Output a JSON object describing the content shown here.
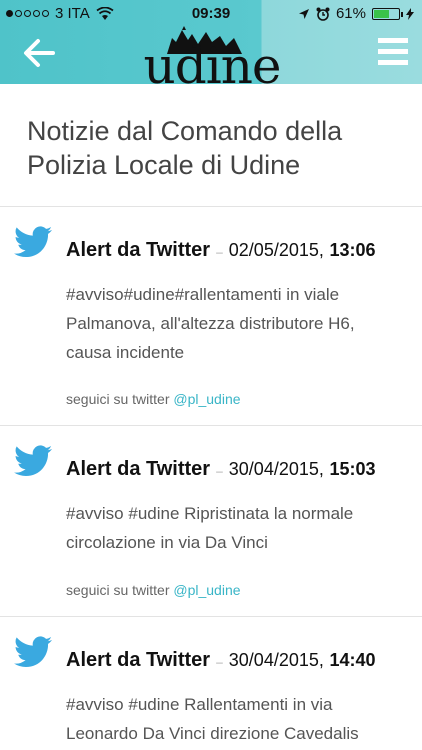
{
  "status_bar": {
    "carrier": "3 ITA",
    "time": "09:39",
    "battery": "61%"
  },
  "header": {
    "logo_text": "udine"
  },
  "page": {
    "title": "Notizie dal Comando della Polizia Locale di Udine"
  },
  "alerts": [
    {
      "source": "Alert da Twitter",
      "date": "02/05/2015,",
      "time": "13:06",
      "text": "#avviso#udine#rallentamenti in viale Palmanova, all'altezza distributore H6, causa incidente",
      "follow_label": "seguici su twitter",
      "handle": "@pl_udine"
    },
    {
      "source": "Alert da Twitter",
      "date": "30/04/2015,",
      "time": "15:03",
      "text": "#avviso #udine Ripristinata la normale circolazione in via Da Vinci",
      "follow_label": "seguici su twitter",
      "handle": "@pl_udine"
    },
    {
      "source": "Alert da Twitter",
      "date": "30/04/2015,",
      "time": "14:40",
      "text": "#avviso #udine Rallentamenti in via Leonardo Da Vinci direzione Cavedalis davan-",
      "follow_label": "",
      "handle": ""
    }
  ],
  "colors": {
    "header_bg": "#4fc3c9",
    "link": "#39b5c7",
    "twitter_bird": "#3aa9e0"
  }
}
